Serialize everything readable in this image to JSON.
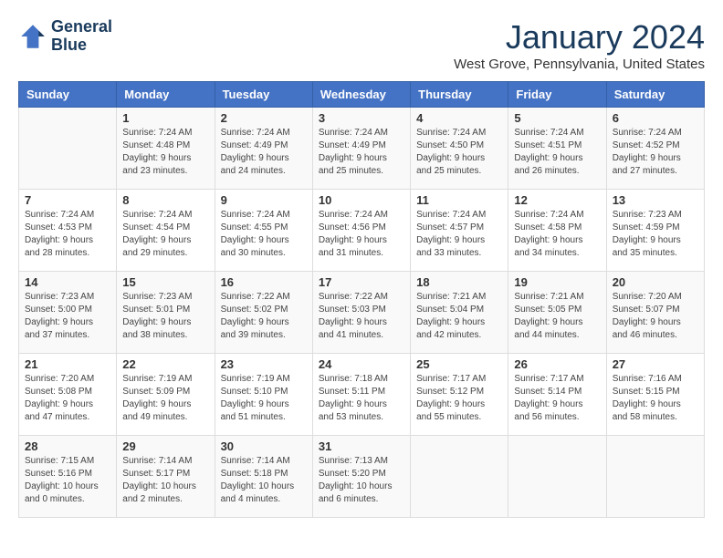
{
  "header": {
    "logo_line1": "General",
    "logo_line2": "Blue",
    "month_title": "January 2024",
    "subtitle": "West Grove, Pennsylvania, United States"
  },
  "calendar": {
    "days_of_week": [
      "Sunday",
      "Monday",
      "Tuesday",
      "Wednesday",
      "Thursday",
      "Friday",
      "Saturday"
    ],
    "weeks": [
      [
        {
          "day": "",
          "sunrise": "",
          "sunset": "",
          "daylight": ""
        },
        {
          "day": "1",
          "sunrise": "Sunrise: 7:24 AM",
          "sunset": "Sunset: 4:48 PM",
          "daylight": "Daylight: 9 hours and 23 minutes."
        },
        {
          "day": "2",
          "sunrise": "Sunrise: 7:24 AM",
          "sunset": "Sunset: 4:49 PM",
          "daylight": "Daylight: 9 hours and 24 minutes."
        },
        {
          "day": "3",
          "sunrise": "Sunrise: 7:24 AM",
          "sunset": "Sunset: 4:49 PM",
          "daylight": "Daylight: 9 hours and 25 minutes."
        },
        {
          "day": "4",
          "sunrise": "Sunrise: 7:24 AM",
          "sunset": "Sunset: 4:50 PM",
          "daylight": "Daylight: 9 hours and 25 minutes."
        },
        {
          "day": "5",
          "sunrise": "Sunrise: 7:24 AM",
          "sunset": "Sunset: 4:51 PM",
          "daylight": "Daylight: 9 hours and 26 minutes."
        },
        {
          "day": "6",
          "sunrise": "Sunrise: 7:24 AM",
          "sunset": "Sunset: 4:52 PM",
          "daylight": "Daylight: 9 hours and 27 minutes."
        }
      ],
      [
        {
          "day": "7",
          "sunrise": "Sunrise: 7:24 AM",
          "sunset": "Sunset: 4:53 PM",
          "daylight": "Daylight: 9 hours and 28 minutes."
        },
        {
          "day": "8",
          "sunrise": "Sunrise: 7:24 AM",
          "sunset": "Sunset: 4:54 PM",
          "daylight": "Daylight: 9 hours and 29 minutes."
        },
        {
          "day": "9",
          "sunrise": "Sunrise: 7:24 AM",
          "sunset": "Sunset: 4:55 PM",
          "daylight": "Daylight: 9 hours and 30 minutes."
        },
        {
          "day": "10",
          "sunrise": "Sunrise: 7:24 AM",
          "sunset": "Sunset: 4:56 PM",
          "daylight": "Daylight: 9 hours and 31 minutes."
        },
        {
          "day": "11",
          "sunrise": "Sunrise: 7:24 AM",
          "sunset": "Sunset: 4:57 PM",
          "daylight": "Daylight: 9 hours and 33 minutes."
        },
        {
          "day": "12",
          "sunrise": "Sunrise: 7:24 AM",
          "sunset": "Sunset: 4:58 PM",
          "daylight": "Daylight: 9 hours and 34 minutes."
        },
        {
          "day": "13",
          "sunrise": "Sunrise: 7:23 AM",
          "sunset": "Sunset: 4:59 PM",
          "daylight": "Daylight: 9 hours and 35 minutes."
        }
      ],
      [
        {
          "day": "14",
          "sunrise": "Sunrise: 7:23 AM",
          "sunset": "Sunset: 5:00 PM",
          "daylight": "Daylight: 9 hours and 37 minutes."
        },
        {
          "day": "15",
          "sunrise": "Sunrise: 7:23 AM",
          "sunset": "Sunset: 5:01 PM",
          "daylight": "Daylight: 9 hours and 38 minutes."
        },
        {
          "day": "16",
          "sunrise": "Sunrise: 7:22 AM",
          "sunset": "Sunset: 5:02 PM",
          "daylight": "Daylight: 9 hours and 39 minutes."
        },
        {
          "day": "17",
          "sunrise": "Sunrise: 7:22 AM",
          "sunset": "Sunset: 5:03 PM",
          "daylight": "Daylight: 9 hours and 41 minutes."
        },
        {
          "day": "18",
          "sunrise": "Sunrise: 7:21 AM",
          "sunset": "Sunset: 5:04 PM",
          "daylight": "Daylight: 9 hours and 42 minutes."
        },
        {
          "day": "19",
          "sunrise": "Sunrise: 7:21 AM",
          "sunset": "Sunset: 5:05 PM",
          "daylight": "Daylight: 9 hours and 44 minutes."
        },
        {
          "day": "20",
          "sunrise": "Sunrise: 7:20 AM",
          "sunset": "Sunset: 5:07 PM",
          "daylight": "Daylight: 9 hours and 46 minutes."
        }
      ],
      [
        {
          "day": "21",
          "sunrise": "Sunrise: 7:20 AM",
          "sunset": "Sunset: 5:08 PM",
          "daylight": "Daylight: 9 hours and 47 minutes."
        },
        {
          "day": "22",
          "sunrise": "Sunrise: 7:19 AM",
          "sunset": "Sunset: 5:09 PM",
          "daylight": "Daylight: 9 hours and 49 minutes."
        },
        {
          "day": "23",
          "sunrise": "Sunrise: 7:19 AM",
          "sunset": "Sunset: 5:10 PM",
          "daylight": "Daylight: 9 hours and 51 minutes."
        },
        {
          "day": "24",
          "sunrise": "Sunrise: 7:18 AM",
          "sunset": "Sunset: 5:11 PM",
          "daylight": "Daylight: 9 hours and 53 minutes."
        },
        {
          "day": "25",
          "sunrise": "Sunrise: 7:17 AM",
          "sunset": "Sunset: 5:12 PM",
          "daylight": "Daylight: 9 hours and 55 minutes."
        },
        {
          "day": "26",
          "sunrise": "Sunrise: 7:17 AM",
          "sunset": "Sunset: 5:14 PM",
          "daylight": "Daylight: 9 hours and 56 minutes."
        },
        {
          "day": "27",
          "sunrise": "Sunrise: 7:16 AM",
          "sunset": "Sunset: 5:15 PM",
          "daylight": "Daylight: 9 hours and 58 minutes."
        }
      ],
      [
        {
          "day": "28",
          "sunrise": "Sunrise: 7:15 AM",
          "sunset": "Sunset: 5:16 PM",
          "daylight": "Daylight: 10 hours and 0 minutes."
        },
        {
          "day": "29",
          "sunrise": "Sunrise: 7:14 AM",
          "sunset": "Sunset: 5:17 PM",
          "daylight": "Daylight: 10 hours and 2 minutes."
        },
        {
          "day": "30",
          "sunrise": "Sunrise: 7:14 AM",
          "sunset": "Sunset: 5:18 PM",
          "daylight": "Daylight: 10 hours and 4 minutes."
        },
        {
          "day": "31",
          "sunrise": "Sunrise: 7:13 AM",
          "sunset": "Sunset: 5:20 PM",
          "daylight": "Daylight: 10 hours and 6 minutes."
        },
        {
          "day": "",
          "sunrise": "",
          "sunset": "",
          "daylight": ""
        },
        {
          "day": "",
          "sunrise": "",
          "sunset": "",
          "daylight": ""
        },
        {
          "day": "",
          "sunrise": "",
          "sunset": "",
          "daylight": ""
        }
      ]
    ]
  }
}
